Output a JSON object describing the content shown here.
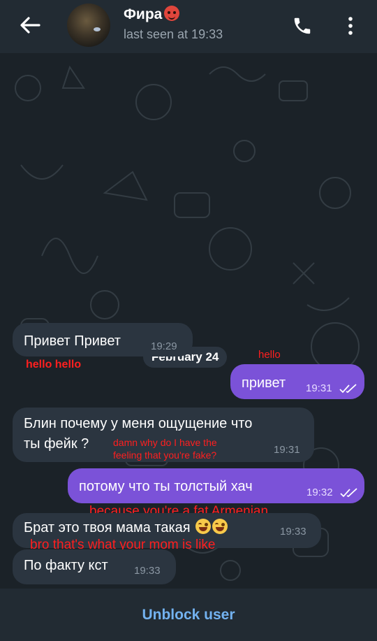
{
  "header": {
    "contact_name": "Фира",
    "contact_emoji_icon": "devil-emoji-icon",
    "last_seen": "last seen at 19:33",
    "back_icon": "arrow-left-icon",
    "call_icon": "phone-icon",
    "menu_icon": "more-vertical-icon"
  },
  "chat": {
    "date_label": "February 24",
    "messages": [
      {
        "direction": "in",
        "text": "Привет Привет",
        "time": "19:29",
        "note": "hello hello"
      },
      {
        "direction": "out",
        "text": "привет",
        "time": "19:31",
        "read": true,
        "note": "hello"
      },
      {
        "direction": "in",
        "text_line1": "Блин почему у меня ощущение что",
        "text_line2": "ты фейк ?",
        "time": "19:31",
        "note_line1": "damn why do I have the",
        "note_line2": "feeling that you're fake?"
      },
      {
        "direction": "out",
        "text": "потому что ты толстый хач",
        "time": "19:32",
        "read": true,
        "note": "because you're a fat Armenian"
      },
      {
        "direction": "in",
        "text": "Брат это твоя мама такая",
        "emoji_icon": "face-with-tears-of-joy-emoji-icon",
        "time": "19:33",
        "note": "bro that's what your mom is like"
      },
      {
        "direction": "in",
        "text": "По факту кст",
        "time": "19:33"
      }
    ]
  },
  "footer": {
    "unblock_label": "Unblock user"
  },
  "colors": {
    "outgoing_bubble": "#7b52d8",
    "incoming_bubble": "#2b3540",
    "annotation_red": "#ff1f1f",
    "link_blue": "#73b2f0"
  }
}
